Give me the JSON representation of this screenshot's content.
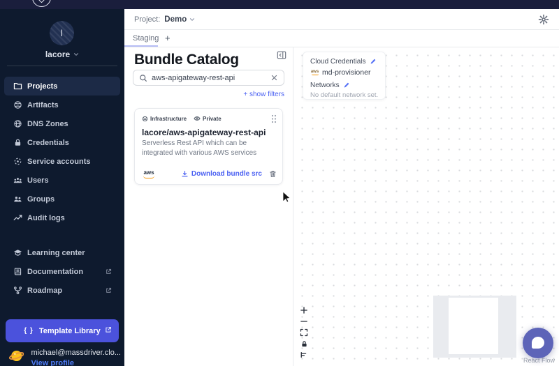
{
  "sidebar": {
    "user": {
      "initial": "l",
      "name": "lacore"
    },
    "nav": [
      {
        "label": "Projects"
      },
      {
        "label": "Artifacts"
      },
      {
        "label": "DNS Zones"
      },
      {
        "label": "Credentials"
      },
      {
        "label": "Service accounts"
      },
      {
        "label": "Users"
      },
      {
        "label": "Groups"
      },
      {
        "label": "Audit logs"
      }
    ],
    "secondary": [
      {
        "label": "Learning center"
      },
      {
        "label": "Documentation"
      },
      {
        "label": "Roadmap"
      }
    ],
    "template_library": {
      "icon_glyph": "{ }",
      "label": "Template Library"
    },
    "profile": {
      "email": "michael@massdriver.clo...",
      "link": "View profile"
    }
  },
  "header": {
    "project_label": "Project:",
    "project_name": "Demo"
  },
  "tabs": {
    "active_tab": "Staging",
    "add_button": "+"
  },
  "catalog": {
    "title": "Bundle Catalog",
    "search_value": "aws-apigateway-rest-api",
    "show_filters_label": "+ show filters",
    "card": {
      "type_badge": "Infrastructure",
      "visibility_badge": "Private",
      "title": "lacore/aws-apigateway-rest-api",
      "description": "Serverless Rest API which can be integrated with various AWS services",
      "logo_text": "aws",
      "download_label": "Download bundle src"
    }
  },
  "canvas_panel": {
    "cloud_credentials_label": "Cloud Credentials",
    "credential_name": "md-provisioner",
    "credential_logo_text": "aws",
    "networks_label": "Networks",
    "networks_empty": "No default network set."
  },
  "attribution": "React Flow",
  "colors": {
    "top_strip": "#1a1e3c",
    "sidebar_bg": "#0e1a2e",
    "active_item_bg": "#1c2a46",
    "template_button": "#4b52dc",
    "link_blue": "#4b61f2",
    "tab_underline": "#b6bdf4",
    "chat_bubble": "#5d64b8",
    "aws_orange": "#f79400"
  }
}
